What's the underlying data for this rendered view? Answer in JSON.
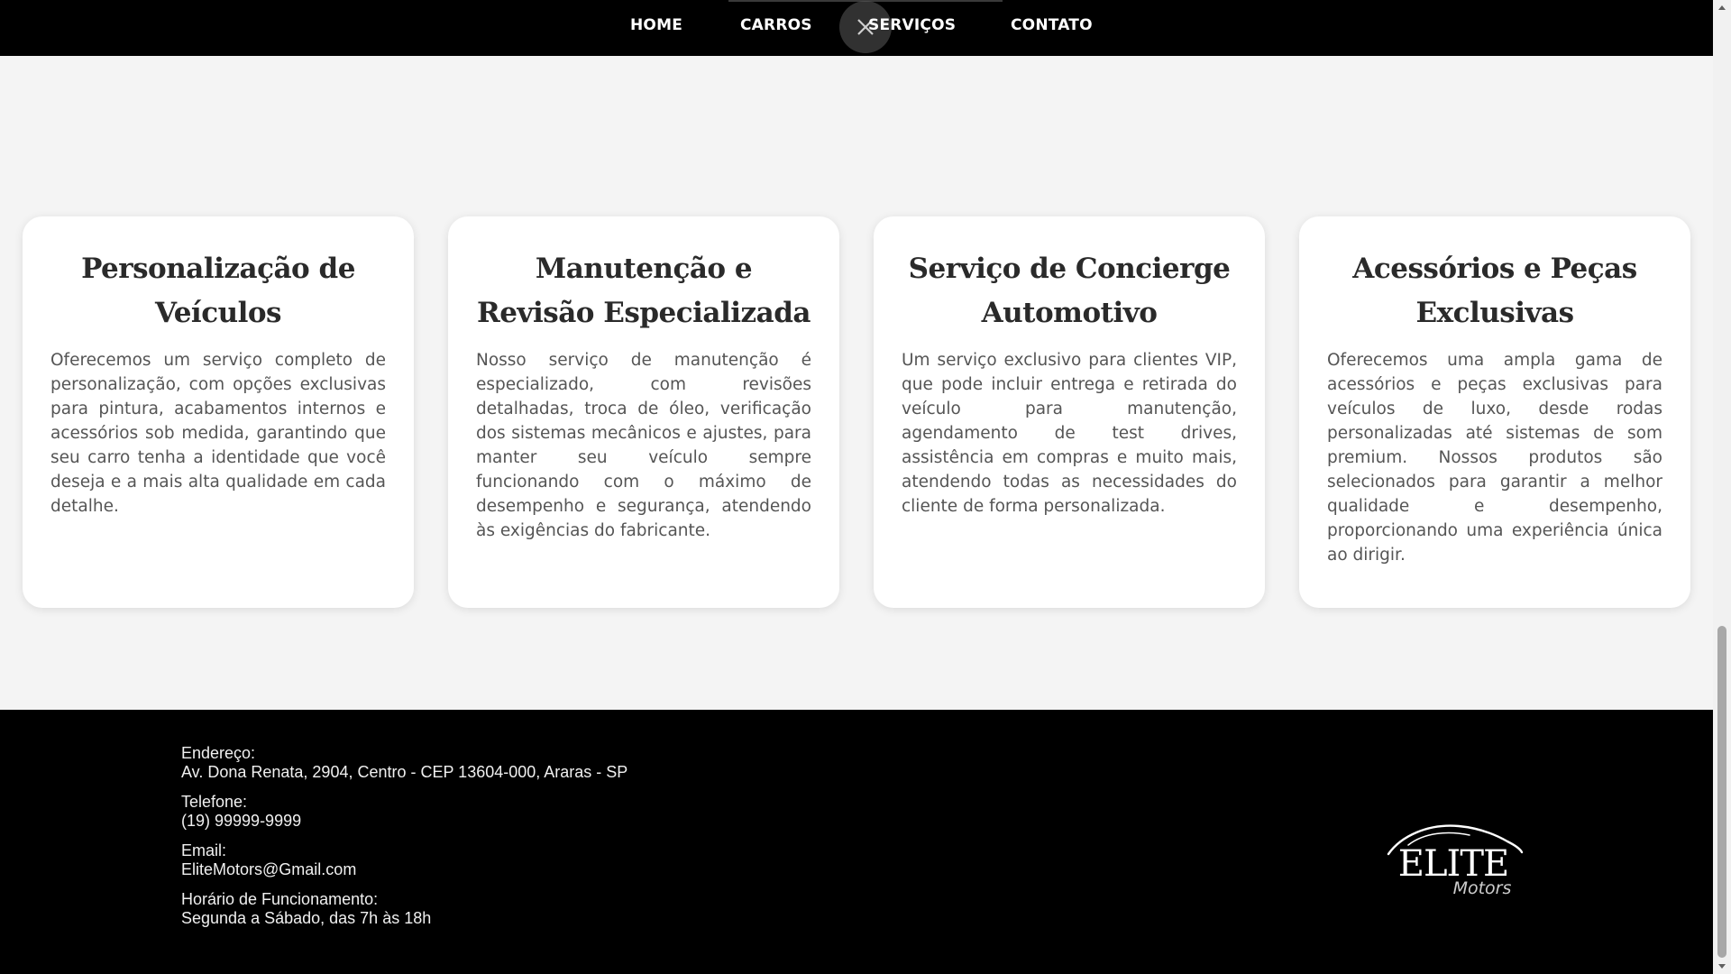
{
  "nav": {
    "items": [
      {
        "label": "HOME"
      },
      {
        "label": "CARROS"
      },
      {
        "label": "SERVIÇOS"
      },
      {
        "label": "CONTATO"
      }
    ],
    "close_icon": "close-icon"
  },
  "services": [
    {
      "title": "Personalização de Veículos",
      "text": "Oferecemos um serviço completo de personalização, com opções exclusivas para pintura, acabamentos internos e acessórios sob medida, garantindo que seu carro tenha a identidade que você deseja e a mais alta qualidade em cada detalhe."
    },
    {
      "title": "Manutenção e Revisão Especializada",
      "text": "Nosso serviço de manutenção é especializado, com revisões detalhadas, troca de óleo, verificação dos sistemas mecânicos e ajustes, para manter seu veículo sempre funcionando com o máximo de desempenho e segurança, atendendo às exigências do fabricante."
    },
    {
      "title": "Serviço de Concierge Automotivo",
      "text": "Um serviço exclusivo para clientes VIP, que pode incluir entrega e retirada do veículo para manutenção, agendamento de test drives, assistência em compras e muito mais, atendendo todas as necessidades do cliente de forma personalizada."
    },
    {
      "title": "Acessórios e Peças Exclusivas",
      "text": "Oferecemos uma ampla gama de acessórios e peças exclusivas para veículos de luxo, desde rodas personalizadas até sistemas de som premium. Nossos produtos são selecionados para garantir a melhor qualidade e desempenho, proporcionando uma experiência única ao dirigir."
    }
  ],
  "footer": {
    "address_label": "Endereço:",
    "address_value": "Av. Dona Renata, 2904, Centro - CEP 13604-000, Araras - SP",
    "phone_label": "Telefone:",
    "phone_value": "(19) 99999-9999",
    "email_label": "Email:",
    "email_value": "EliteMotors@Gmail.com",
    "hours_label": "Horário de Funcionamento:",
    "hours_value": "Segunda a Sábado, das 7h às 18h",
    "logo_main": "ELITE",
    "logo_sub": "Motors"
  },
  "colors": {
    "nav_bg": "#000000",
    "page_bg": "#f4f4f4",
    "card_bg": "#ffffff",
    "title_text": "#2a2a2a",
    "body_text": "#555555",
    "footer_bg": "#000000"
  }
}
